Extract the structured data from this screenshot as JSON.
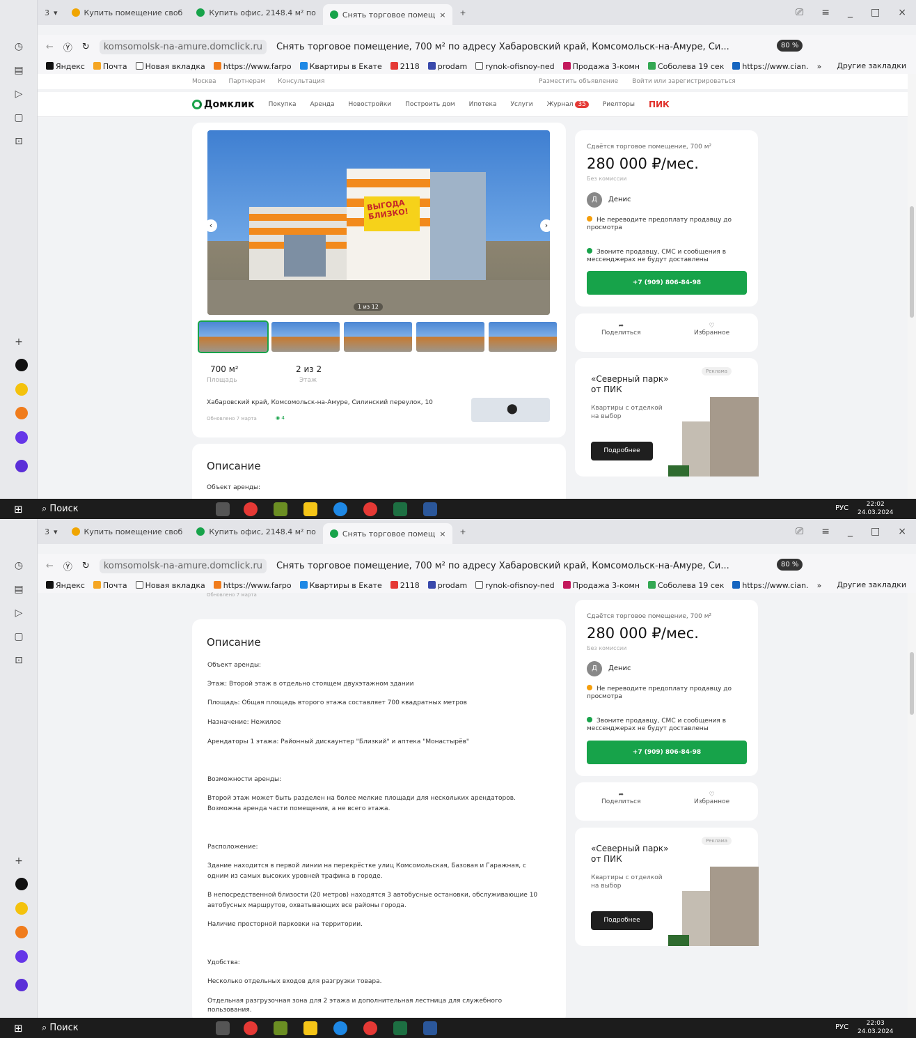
{
  "browser": {
    "tab_count": "3",
    "tabs": [
      {
        "label": "Купить помещение своб"
      },
      {
        "label": "Купить офис, 2148.4 м² по"
      },
      {
        "label": "Снять торговое помещ"
      }
    ],
    "url": "komsomolsk-na-amure.domclick.ru",
    "page_title": "Снять торговое помещение, 700 м² по адресу Хабаровский край, Комсомольск-на-Амуре, Си...",
    "zoom": "80 %",
    "bookmarks": [
      "Яндекс",
      "Почта",
      "Новая вкладка",
      "https://www.farpo",
      "Квартиры в Екате",
      "2118",
      "prodam",
      "rynok-ofisnoy-ned",
      "Продажа 3-комн",
      "Соболева 19 сек",
      "https://www.cian."
    ],
    "bookmarks_more": "»",
    "other_bookmarks": "Другие закладки"
  },
  "site": {
    "util_left": [
      "Москва",
      "Партнерам",
      "Консультация"
    ],
    "util_right": [
      "Разместить объявление",
      "Войти или зарегистрироваться"
    ],
    "logo": "Домклик",
    "nav": [
      "Покупка",
      "Аренда",
      "Новостройки",
      "Построить дом",
      "Ипотека",
      "Услуги",
      "Журнал",
      "Риелторы"
    ],
    "journal_badge": "35",
    "pik": "ПИК"
  },
  "listing": {
    "photo_counter": "1 из 12",
    "photo_sign": "ВЫГОДА БЛИЗКО!",
    "area_value": "700 м²",
    "area_label": "Площадь",
    "floor_value": "2 из 2",
    "floor_label": "Этаж",
    "address": "Хабаровский край, Комсомольск-на-Амуре, Силинский переулок, 10",
    "updated": "Обновлено 7 марта",
    "views": "4",
    "description_heading": "Описание",
    "description_first": "Объект аренды:"
  },
  "sidebar": {
    "offer_title": "Сдаётся торговое помещение, 700 м²",
    "price": "280 000 ₽/мес.",
    "commission": "Без комиссии",
    "seller_initial": "Д",
    "seller_name": "Денис",
    "warning": "Не переводите предоплату продавцу до просмотра",
    "notice": "Звоните продавцу, СМС и сообщения в мессенджерах не будут доставлены",
    "phone": "+7 (909) 806-84-98",
    "share": "Поделиться",
    "favorite": "Избранное"
  },
  "ad": {
    "label": "Реклама",
    "title": "«Северный парк» от ПИК",
    "subtitle": "Квартиры с отделкой на выбор",
    "button": "Подробнее"
  },
  "description": [
    "Объект аренды:",
    "Этаж: Второй этаж в отдельно стоящем двухэтажном здании",
    "Площадь: Общая площадь второго этажа составляет 700 квадратных метров",
    "Назначение: Нежилое",
    "Арендаторы 1 этажа: Районный дискаунтер \"Близкий\" и аптека \"Монастырёв\"",
    "Возможности аренды:",
    "Второй этаж может быть разделен на более мелкие площади для нескольких арендаторов.",
    "Возможна аренда части помещения, а не всего этажа.",
    "Расположение:",
    "Здание находится в первой линии на перекрёстке улиц Комсомольская, Базовая и Гаражная, с",
    "одним из самых высоких уровней трафика в городе.",
    "В непосредственной близости (20 метров) находятся 3 автобусные остановки, обслуживающие 10",
    "автобусных маршрутов, охватывающих все районы города.",
    "Наличие просторной парковки на территории.",
    "Удобства:",
    "Несколько отдельных входов для разгрузки товара.",
    "Отдельная разгрузочная зона для 2 этажа и дополнительная лестница для служебного",
    "пользования."
  ],
  "taskbar": {
    "search": "Поиск",
    "lang": "РУС",
    "time1": "22:02",
    "date1": "24.03.2024",
    "time2": "22:03",
    "date2": "24.03.2024"
  }
}
